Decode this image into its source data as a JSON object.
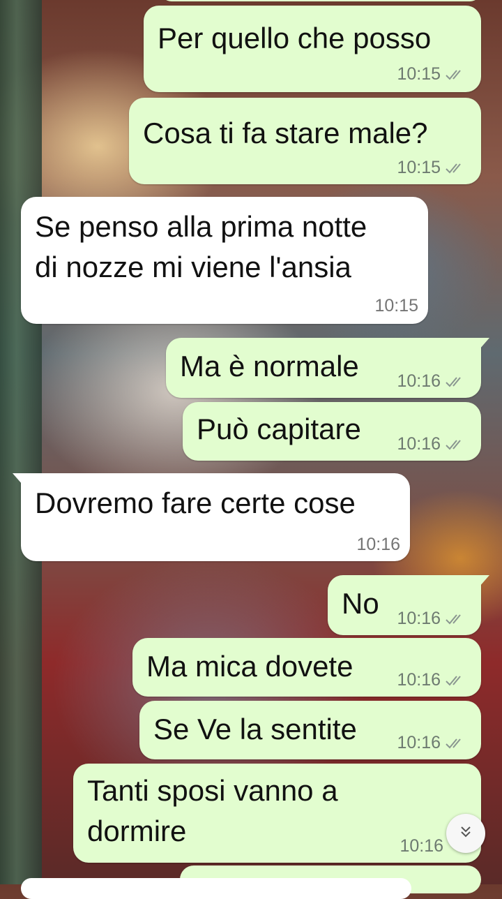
{
  "messages": [
    {
      "text": "Per quello che posso",
      "time": "10:15",
      "direction": "out",
      "status": "read"
    },
    {
      "text": "Cosa ti fa stare male?",
      "time": "10:15",
      "direction": "out",
      "status": "read"
    },
    {
      "text_line1": "Se penso alla prima notte",
      "text_line2": "di nozze mi viene l'ansia",
      "time": "10:15",
      "direction": "in"
    },
    {
      "text": "Ma è normale",
      "time": "10:16",
      "direction": "out",
      "status": "read"
    },
    {
      "text": "Può capitare",
      "time": "10:16",
      "direction": "out",
      "status": "read"
    },
    {
      "text": "Dovremo fare certe cose",
      "time": "10:16",
      "direction": "in"
    },
    {
      "text": "No",
      "time": "10:16",
      "direction": "out",
      "status": "read"
    },
    {
      "text": "Ma mica dovete",
      "time": "10:16",
      "direction": "out",
      "status": "read"
    },
    {
      "text": "Se Ve la sentite",
      "time": "10:16",
      "direction": "out",
      "status": "read"
    },
    {
      "text_line1": "Tanti sposi vanno a",
      "text_line2": "dormire",
      "time": "10:16",
      "direction": "out"
    }
  ],
  "icons": {
    "read_receipt": "double-check-icon",
    "scroll_down": "double-chevron-down-icon"
  },
  "colors": {
    "outgoing_bubble": "#e2fdcf",
    "incoming_bubble": "#ffffff",
    "check": "#8a9690"
  }
}
